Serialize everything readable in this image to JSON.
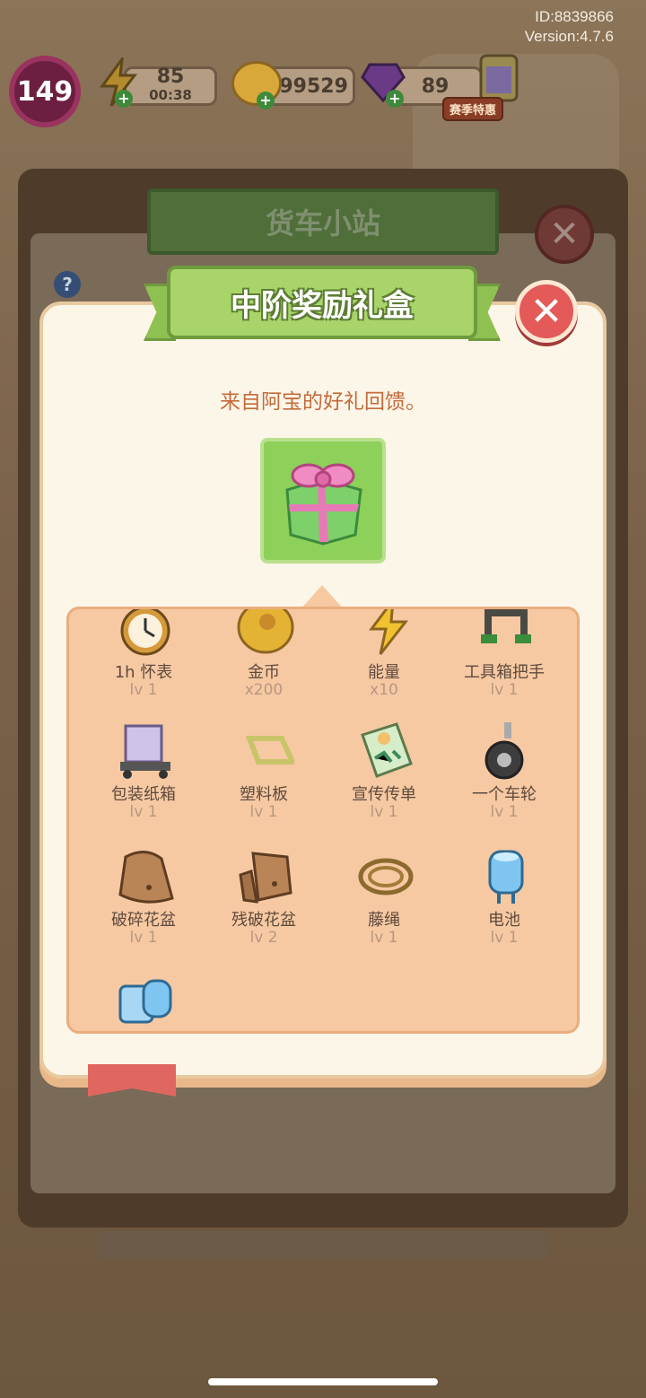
{
  "hud": {
    "id_text": "ID:8839866",
    "version_text": "Version:4.7.6",
    "level": "149",
    "energy": {
      "value": "85",
      "timer": "00:38"
    },
    "coins": {
      "value": "499529"
    },
    "gems": {
      "value": "89"
    },
    "season_label": "赛季特惠"
  },
  "background": {
    "panel_title": "货车小站",
    "help_icon": "?"
  },
  "dialog": {
    "title": "中阶奖励礼盒",
    "close_label": "✕",
    "subtitle": "来自阿宝的好礼回馈。",
    "gift_icon": "gift-box-icon"
  },
  "rewards": [
    {
      "name": "1h 怀表",
      "level": "lv 1",
      "icon": "pocket-watch-icon"
    },
    {
      "name": "金币",
      "level": "x200",
      "icon": "coin-icon"
    },
    {
      "name": "能量",
      "level": "x10",
      "icon": "lightning-icon"
    },
    {
      "name": "工具箱把手",
      "level": "lv 1",
      "icon": "toolbox-handle-icon"
    },
    {
      "name": "包装纸箱",
      "level": "lv 1",
      "icon": "cardboard-box-icon"
    },
    {
      "name": "塑料板",
      "level": "lv 1",
      "icon": "plastic-board-icon"
    },
    {
      "name": "宣传传单",
      "level": "lv 1",
      "icon": "flyer-icon"
    },
    {
      "name": "一个车轮",
      "level": "lv 1",
      "icon": "wheel-icon"
    },
    {
      "name": "破碎花盆",
      "level": "lv 1",
      "icon": "broken-pot-icon"
    },
    {
      "name": "残破花盆",
      "level": "lv 2",
      "icon": "damaged-pot-icon"
    },
    {
      "name": "藤绳",
      "level": "lv 1",
      "icon": "rope-icon"
    },
    {
      "name": "电池",
      "level": "lv 1",
      "icon": "battery-icon"
    },
    {
      "name": "",
      "level": "",
      "icon": "battery-pack-icon"
    }
  ]
}
